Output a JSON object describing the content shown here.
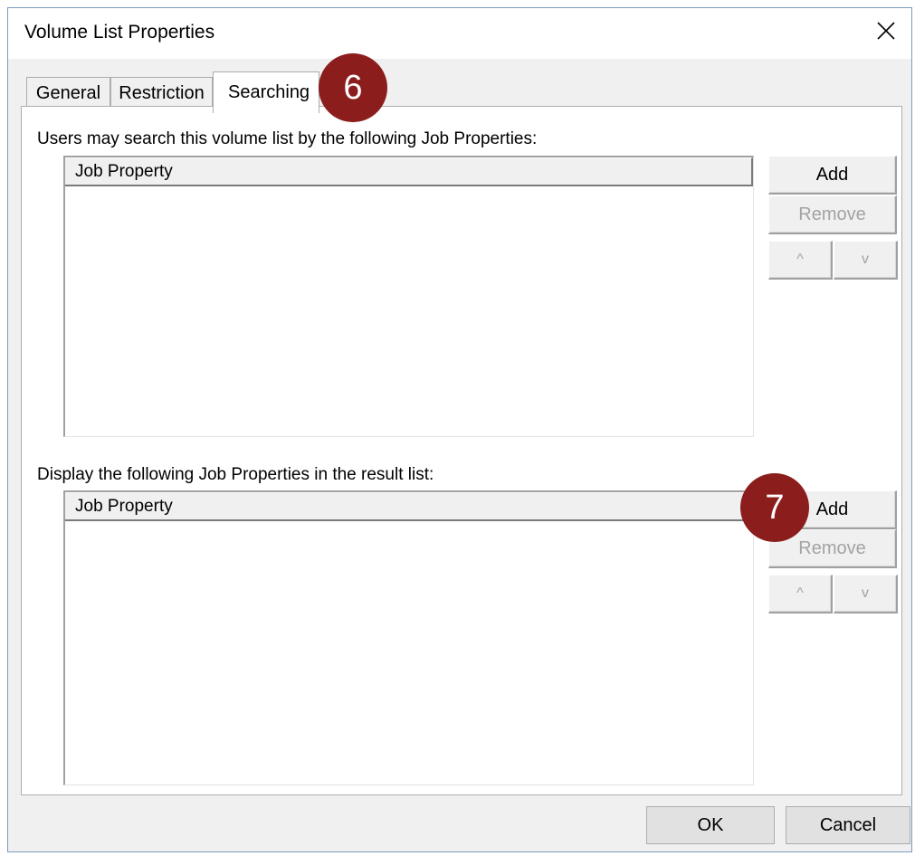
{
  "window": {
    "title": "Volume List Properties",
    "close_icon": "close-icon"
  },
  "tabs": [
    {
      "label": "General",
      "active": false
    },
    {
      "label": "Restriction",
      "active": false
    },
    {
      "label": "Searching",
      "active": true
    }
  ],
  "search_section": {
    "label": "Users may search this volume list by the following Job Properties:",
    "column_header": "Job Property",
    "add_label": "Add",
    "remove_label": "Remove",
    "up_label": "^",
    "down_label": "v"
  },
  "display_section": {
    "label": "Display the following Job Properties in the result list:",
    "column_header": "Job Property",
    "add_label": "Add",
    "remove_label": "Remove",
    "up_label": "^",
    "down_label": "v"
  },
  "badges": {
    "six": "6",
    "seven": "7",
    "color": "#8b1d1d"
  },
  "footer": {
    "ok_label": "OK",
    "cancel_label": "Cancel"
  }
}
